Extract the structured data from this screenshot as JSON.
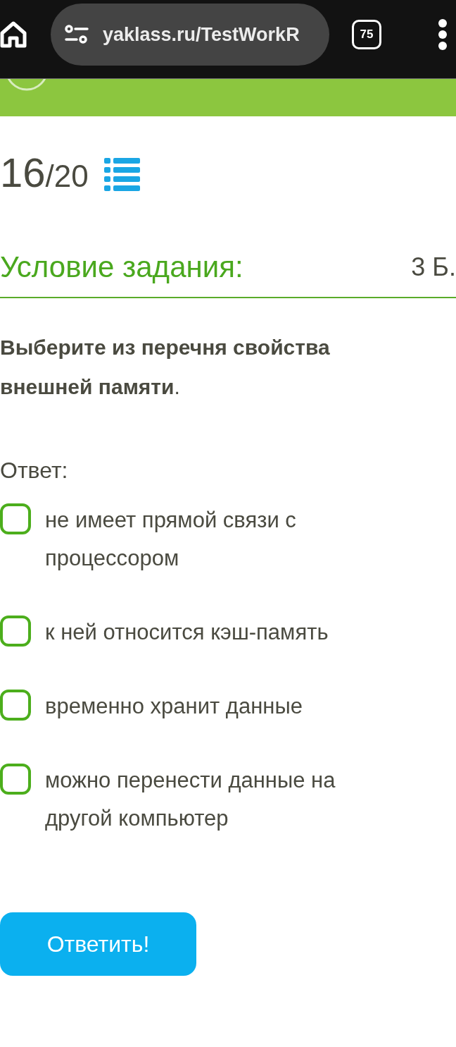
{
  "browser": {
    "url": "yaklass.ru/TestWorkR",
    "tab_count": "75"
  },
  "progress": {
    "current": "16",
    "total": "/20"
  },
  "task": {
    "heading": "Условие задания:",
    "points": "3 Б.",
    "question": "**Выберите из перечня свойства внешней памяти**.",
    "answer_label": "Ответ:"
  },
  "options": [
    {
      "label": "не имеет прямой связи с процессором",
      "checked": false
    },
    {
      "label": "к ней относится кэш-память",
      "checked": false
    },
    {
      "label": "временно хранит данные",
      "checked": false
    },
    {
      "label": "можно перенести данные на другой компьютер",
      "checked": false
    }
  ],
  "submit_button": "Ответить!"
}
